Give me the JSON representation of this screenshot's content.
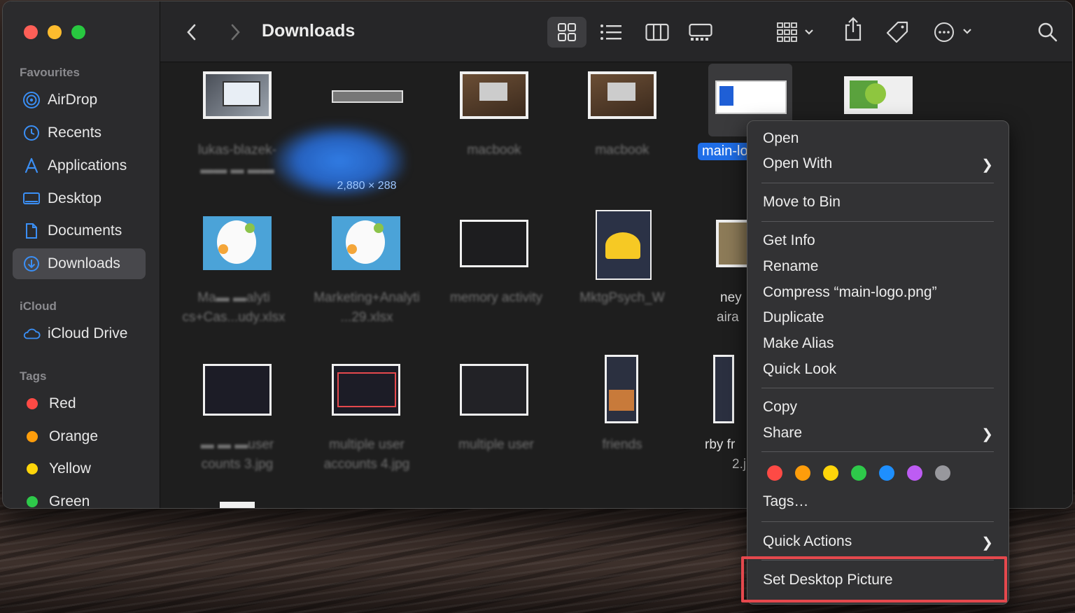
{
  "window": {
    "title": "Downloads"
  },
  "sidebar": {
    "favourites_heading": "Favourites",
    "favourites": [
      {
        "label": "AirDrop",
        "icon": "airdrop-icon"
      },
      {
        "label": "Recents",
        "icon": "clock-icon"
      },
      {
        "label": "Applications",
        "icon": "applications-icon"
      },
      {
        "label": "Desktop",
        "icon": "desktop-icon"
      },
      {
        "label": "Documents",
        "icon": "document-icon"
      },
      {
        "label": "Downloads",
        "icon": "download-icon",
        "selected": true
      }
    ],
    "icloud_heading": "iCloud",
    "icloud": [
      {
        "label": "iCloud Drive",
        "icon": "cloud-icon"
      }
    ],
    "tags_heading": "Tags",
    "tags": [
      {
        "label": "Red",
        "color": "#fe4a45"
      },
      {
        "label": "Orange",
        "color": "#fe9d0b"
      },
      {
        "label": "Yellow",
        "color": "#fed50a"
      },
      {
        "label": "Green",
        "color": "#2ec94a"
      }
    ]
  },
  "toolbar": {
    "icons": [
      "back-icon",
      "forward-icon",
      "icon-view-icon",
      "list-view-icon",
      "column-view-icon",
      "gallery-view-icon",
      "group-icon",
      "share-icon",
      "tag-icon",
      "more-icon",
      "search-icon"
    ]
  },
  "files": {
    "selected_name": "main-lo",
    "dimensions": "2,880 × 288",
    "labels": [
      "lukas-blazek-",
      "macbook",
      "macbook",
      "Marketing+Analyti",
      "memory activity",
      "MktgPsych_W",
      "ney",
      "aira",
      "multiple user",
      "multiple user",
      "multiple user",
      "friends",
      "rby fr",
      "2.j",
      "counts 3.jpg",
      "accounts 4.jpg",
      "cs+Cas...udy.xlsx",
      "...29.xlsx"
    ]
  },
  "context_menu": {
    "items": [
      {
        "label": "Open"
      },
      {
        "label": "Open With",
        "submenu": true
      },
      {
        "label": "Move to Bin"
      },
      {
        "label": "Get Info"
      },
      {
        "label": "Rename"
      },
      {
        "label": "Compress “main-logo.png”"
      },
      {
        "label": "Duplicate"
      },
      {
        "label": "Make Alias"
      },
      {
        "label": "Quick Look"
      },
      {
        "label": "Copy"
      },
      {
        "label": "Share",
        "submenu": true
      },
      {
        "label": "Tags…"
      },
      {
        "label": "Quick Actions",
        "submenu": true
      },
      {
        "label": "Set Desktop Picture",
        "highlighted": true
      }
    ],
    "tag_colors": [
      "#fe4a45",
      "#fe9d0b",
      "#fed50a",
      "#2ec94a",
      "#1e8ffe",
      "#bd5cf3",
      "#98989d"
    ],
    "highlight_color": "#e5484d"
  }
}
